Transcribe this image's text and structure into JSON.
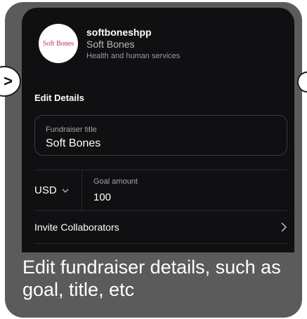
{
  "profile": {
    "logo_text": "Soft Bones",
    "handle": "softboneshpp",
    "name": "Soft Bones",
    "category": "Health and human services"
  },
  "edit_details": {
    "section_title": "Edit Details",
    "fundraiser_title_label": "Fundraiser title",
    "fundraiser_title_value": "Soft Bones",
    "currency": "USD",
    "goal_label": "Goal amount",
    "goal_value": "100",
    "invite_label": "Invite Collaborators"
  },
  "caption": "Edit fundraiser details, such as goal, title, etc",
  "nav": {
    "prev_symbol": ">"
  },
  "icons": [
    "chevron-down-icon",
    "chevron-right-icon"
  ]
}
